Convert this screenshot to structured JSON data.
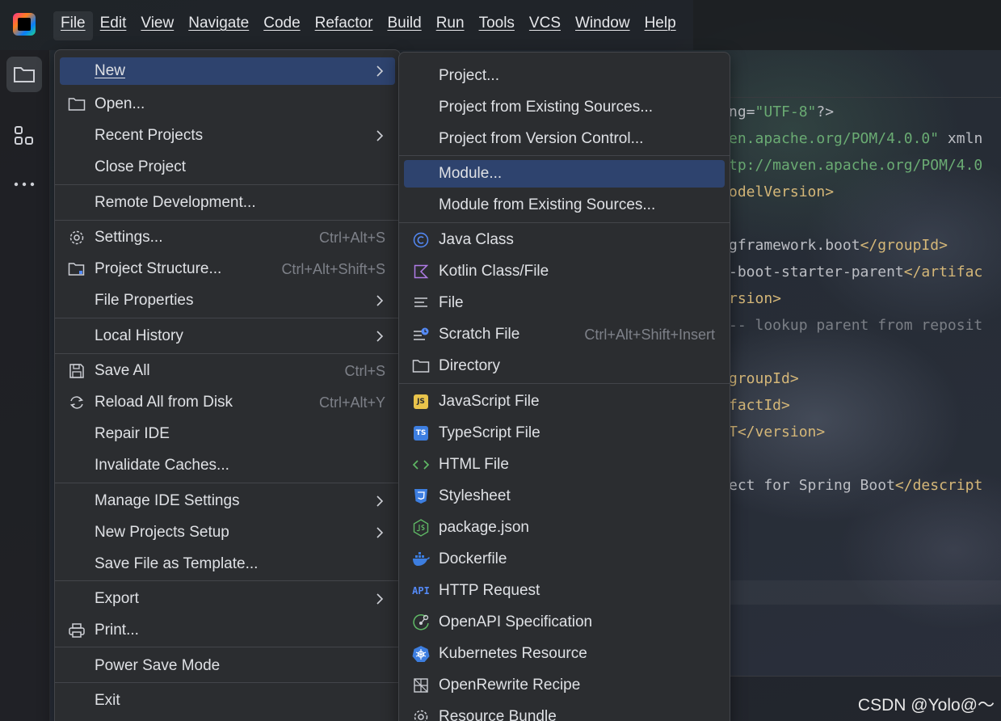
{
  "menubar": {
    "items": [
      "File",
      "Edit",
      "View",
      "Navigate",
      "Code",
      "Refactor",
      "Build",
      "Run",
      "Tools",
      "VCS",
      "Window",
      "Help"
    ],
    "active": "File"
  },
  "file_menu": {
    "new": "New",
    "open": "Open...",
    "recent_projects": "Recent Projects",
    "close_project": "Close Project",
    "remote_development": "Remote Development...",
    "settings": "Settings...",
    "settings_shortcut": "Ctrl+Alt+S",
    "project_structure": "Project Structure...",
    "project_structure_shortcut": "Ctrl+Alt+Shift+S",
    "file_properties": "File Properties",
    "local_history": "Local History",
    "save_all": "Save All",
    "save_all_shortcut": "Ctrl+S",
    "reload_all": "Reload All from Disk",
    "reload_all_shortcut": "Ctrl+Alt+Y",
    "repair_ide": "Repair IDE",
    "invalidate_caches": "Invalidate Caches...",
    "manage_ide_settings": "Manage IDE Settings",
    "new_projects_setup": "New Projects Setup",
    "save_file_as_template": "Save File as Template...",
    "export": "Export",
    "print": "Print...",
    "power_save_mode": "Power Save Mode",
    "exit": "Exit"
  },
  "new_menu": {
    "project": "Project...",
    "project_existing_sources": "Project from Existing Sources...",
    "project_vcs": "Project from Version Control...",
    "module": "Module...",
    "module_existing_sources": "Module from Existing Sources...",
    "java_class": "Java Class",
    "kotlin_class": "Kotlin Class/File",
    "file": "File",
    "scratch_file": "Scratch File",
    "scratch_file_shortcut": "Ctrl+Alt+Shift+Insert",
    "directory": "Directory",
    "javascript_file": "JavaScript File",
    "typescript_file": "TypeScript File",
    "html_file": "HTML File",
    "stylesheet": "Stylesheet",
    "package_json": "package.json",
    "dockerfile": "Dockerfile",
    "http_request": "HTTP Request",
    "openapi_spec": "OpenAPI Specification",
    "kubernetes_resource": "Kubernetes Resource",
    "openrewrite_recipe": "OpenRewrite Recipe",
    "resource_bundle": "Resource Bundle"
  },
  "badges": {
    "js": "JS",
    "ts": "TS",
    "api": "API"
  },
  "editor": {
    "lines": [
      {
        "parts": [
          [
            "c-txt",
            "ng="
          ],
          [
            "c-str",
            "\"UTF-8\""
          ],
          [
            "c-txt",
            "?>"
          ]
        ]
      },
      {
        "parts": [
          [
            "c-str",
            "en.apache.org/POM/4.0.0\""
          ],
          [
            "c-txt",
            " xmln"
          ]
        ]
      },
      {
        "parts": [
          [
            "c-str",
            "tp://maven.apache.org/POM/4.0"
          ]
        ]
      },
      {
        "parts": [
          [
            "c-tag",
            "odelVersion>"
          ]
        ]
      },
      {
        "parts": []
      },
      {
        "parts": [
          [
            "c-txt",
            "gframework.boot"
          ],
          [
            "c-tag",
            "</groupId>"
          ]
        ]
      },
      {
        "parts": [
          [
            "c-txt",
            "-boot-starter-parent"
          ],
          [
            "c-tag",
            "</artifac"
          ]
        ]
      },
      {
        "parts": [
          [
            "c-tag",
            "rsion>"
          ]
        ]
      },
      {
        "parts": [
          [
            "c-cmt",
            "-- lookup parent from reposit"
          ]
        ]
      },
      {
        "parts": []
      },
      {
        "parts": [
          [
            "c-tag",
            "groupId>"
          ]
        ]
      },
      {
        "parts": [
          [
            "c-tag",
            "factId>"
          ]
        ]
      },
      {
        "parts": [
          [
            "c-tag",
            "T</version>"
          ]
        ]
      },
      {
        "parts": []
      },
      {
        "parts": [
          [
            "c-txt",
            "ect for Spring Boot"
          ],
          [
            "c-tag",
            "</descript"
          ]
        ]
      }
    ]
  },
  "colors": {
    "selection": "#2e436e",
    "menu_bg": "#2b2d30",
    "java_icon": "#548af7",
    "kotlin_icon": "#b07ce6"
  },
  "watermark": "CSDN @Yolo@～"
}
